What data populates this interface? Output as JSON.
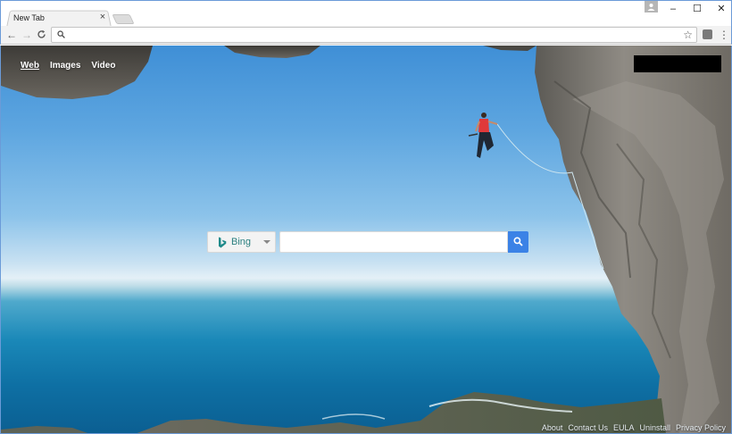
{
  "browser": {
    "tab_title": "New Tab",
    "tab_close": "×",
    "address_value": "",
    "window_controls": {
      "minimize": "–",
      "maximize": "☐",
      "close": "✕"
    },
    "nav": {
      "back": "←",
      "forward": "→",
      "reload": "C"
    },
    "star": "☆",
    "menu": "⋮"
  },
  "page": {
    "nav_links": [
      {
        "label": "Web",
        "active": true
      },
      {
        "label": "Images",
        "active": false
      },
      {
        "label": "Video",
        "active": false
      }
    ],
    "search": {
      "engine": "Bing",
      "engine_icon": "bing-logo-icon",
      "placeholder": "",
      "value": "",
      "button_icon": "search-icon"
    },
    "footer_links": [
      "About",
      "Contact Us",
      "EULA",
      "Uninstall",
      "Privacy Policy"
    ]
  },
  "colors": {
    "accent_button": "#3b82e6",
    "engine_text": "#2a7f7f",
    "window_border": "#6b9bd8"
  }
}
